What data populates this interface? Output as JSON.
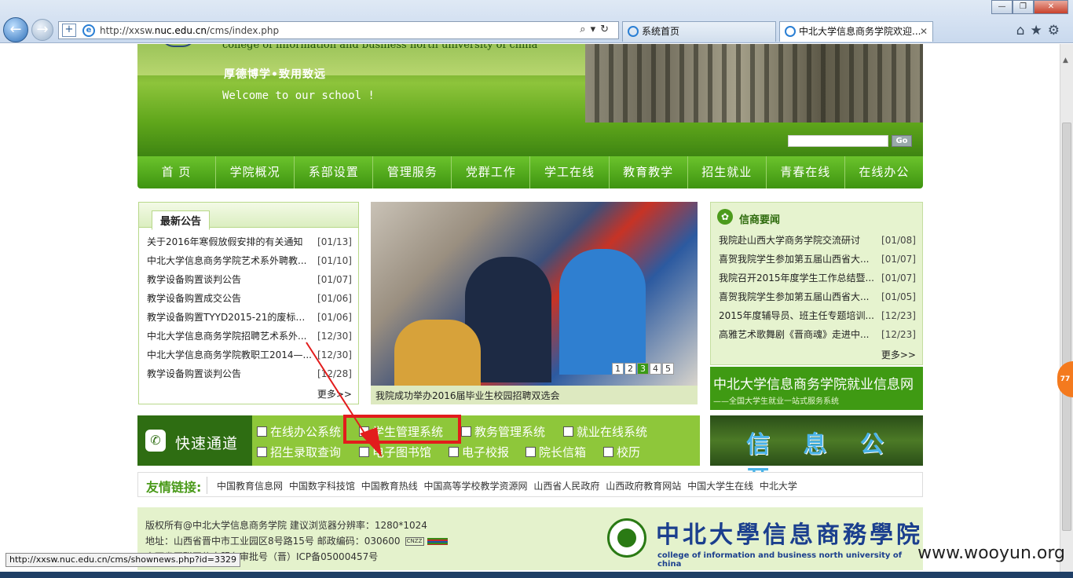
{
  "browser": {
    "url_prefix": "http://xxsw.",
    "url_domain": "nuc.edu.cn",
    "url_path": "/cms/index.php",
    "tabs": [
      {
        "title": "系统首页"
      },
      {
        "title": "中北大学信息商务学院欢迎..."
      }
    ],
    "status_url": "http://xxsw.nuc.edu.cn/cms/shownews.php?id=3329"
  },
  "banner": {
    "english_name": "college of information and business north university of china",
    "motto": "厚德博学•致用致远",
    "welcome": "Welcome to our school !",
    "search_button": "Go"
  },
  "nav": [
    "首 页",
    "学院概况",
    "系部设置",
    "管理服务",
    "党群工作",
    "学工在线",
    "教育教学",
    "招生就业",
    "青春在线",
    "在线办公"
  ],
  "notices": {
    "title": "最新公告",
    "items": [
      {
        "text": "关于2016年寒假放假安排的有关通知",
        "date": "[01/13]"
      },
      {
        "text": "中北大学信息商务学院艺术系外聘教...",
        "date": "[01/10]"
      },
      {
        "text": "教学设备购置谈判公告",
        "date": "[01/07]"
      },
      {
        "text": "教学设备购置成交公告",
        "date": "[01/06]"
      },
      {
        "text": "教学设备购置TYYD2015-21的废标公告",
        "date": "[01/06]"
      },
      {
        "text": "中北大学信息商务学院招聘艺术系外...",
        "date": "[12/30]"
      },
      {
        "text": "中北大学信息商务学院教职工2014—...",
        "date": "[12/30]"
      },
      {
        "text": "教学设备购置谈判公告",
        "date": "[12/28]"
      }
    ],
    "more": "更多>>"
  },
  "photo": {
    "caption": "我院成功举办2016届毕业生校园招聘双选会",
    "pages": [
      "1",
      "2",
      "3",
      "4",
      "5"
    ],
    "active_page": "3"
  },
  "news": {
    "title": "信商要闻",
    "items": [
      {
        "text": "我院赴山西大学商务学院交流研讨",
        "date": "[01/08]"
      },
      {
        "text": "喜贺我院学生参加第五届山西省大...",
        "date": "[01/07]"
      },
      {
        "text": "我院召开2015年度学生工作总结暨...",
        "date": "[01/07]"
      },
      {
        "text": "喜贺我院学生参加第五届山西省大...",
        "date": "[01/05]"
      },
      {
        "text": "2015年度辅导员、班主任专题培训...",
        "date": "[12/23]"
      },
      {
        "text": "高雅艺术歌舞剧《晋商魂》走进中...",
        "date": "[12/23]"
      }
    ],
    "more": "更多>>"
  },
  "jobs": {
    "title": "中北大学信息商务学院就业信息网",
    "subtitle": "——全国大学生就业一站式服务系统"
  },
  "quick": {
    "label": "快速通道",
    "links": [
      "在线办公系统",
      "学生管理系统",
      "教务管理系统",
      "就业在线系统",
      "招生录取查询",
      "电子图书馆",
      "电子校报",
      "院长信箱",
      "校历"
    ]
  },
  "info_open": "信 息 公 开",
  "friend_links": {
    "label": "友情链接:",
    "items": [
      "中国教育信息网",
      "中国数字科技馆",
      "中国教育热线",
      "中国高等学校教学资源网",
      "山西省人民政府",
      "山西政府教育网站",
      "中国大学生在线",
      "中北大学"
    ]
  },
  "footer": {
    "line1": "版权所有@中北大学信息商务学院    建议浏览器分辨率：1280*1024",
    "line2": "地址：山西省晋中市工业园区8号路15号    邮政编码：030600",
    "line3": "山西省互联网信息服务审批号（晋）ICP备05000457号",
    "badge": "CNZZ",
    "school_cn": "中北大學信息商務學院",
    "school_en": "college of information and business north university of china"
  },
  "watermark": "www.wooyun.org",
  "side_badge": "77",
  "colors": {
    "highlight": "#e21c1c",
    "nav_green": "#4ea01b",
    "accent_blue": "#1b3f8e"
  }
}
